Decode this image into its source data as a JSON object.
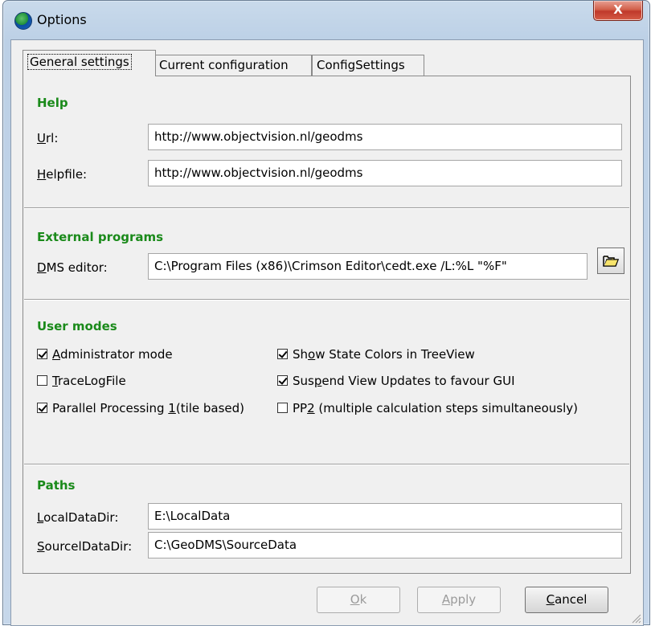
{
  "window": {
    "title": "Options",
    "close_label": "X"
  },
  "tabs": [
    {
      "label": "General settings",
      "active": true
    },
    {
      "label": "Current configuration",
      "active": false
    },
    {
      "label": "ConfigSettings",
      "active": false
    }
  ],
  "help": {
    "title": "Help",
    "url_label_mnemonic": "U",
    "url_label_rest": "rl:",
    "url_value": "http://www.objectvision.nl/geodms",
    "helpfile_label_mnemonic": "H",
    "helpfile_label_rest": "elpfile:",
    "helpfile_value": "http://www.objectvision.nl/geodms"
  },
  "external": {
    "title": "External programs",
    "dms_label_mnemonic": "D",
    "dms_label_rest": "MS editor:",
    "dms_value": "C:\\Program Files (x86)\\Crimson Editor\\cedt.exe /L:%L \"%F\"",
    "browse_icon": "folder-open-icon"
  },
  "user_modes": {
    "title": "User modes",
    "admin": {
      "mnemonic": "A",
      "rest": "dministrator mode",
      "checked": true
    },
    "tracelog": {
      "mnemonic": "T",
      "rest": "raceLogFile",
      "checked": false
    },
    "parallel": {
      "before": "Parallel Processing ",
      "mnemonic": "1",
      "after": "(tile based)",
      "checked": true
    },
    "state_colors": {
      "before": "Sh",
      "mnemonic": "o",
      "after": "w State Colors in TreeView",
      "checked": true
    },
    "suspend": {
      "before": "Sus",
      "mnemonic": "p",
      "after": "end View Updates to favour GUI",
      "checked": true
    },
    "pp2": {
      "before": "PP",
      "mnemonic": "2",
      "after": " (multiple calculation steps simultaneously)",
      "checked": false
    }
  },
  "paths": {
    "title": "Paths",
    "local_mnemonic": "L",
    "local_rest": "ocalDataDir:",
    "local_value": "E:\\LocalData",
    "source_mnemonic": "S",
    "source_rest": "ourcelDataDir:",
    "source_value": "C:\\GeoDMS\\SourceData"
  },
  "buttons": {
    "ok_mnemonic": "O",
    "ok_rest": "k",
    "apply_mnemonic": "A",
    "apply_rest": "pply",
    "cancel_mnemonic": "C",
    "cancel_rest": "ancel"
  },
  "colors": {
    "section_title": "#1a8a1a",
    "close_button": "#c0392b"
  }
}
